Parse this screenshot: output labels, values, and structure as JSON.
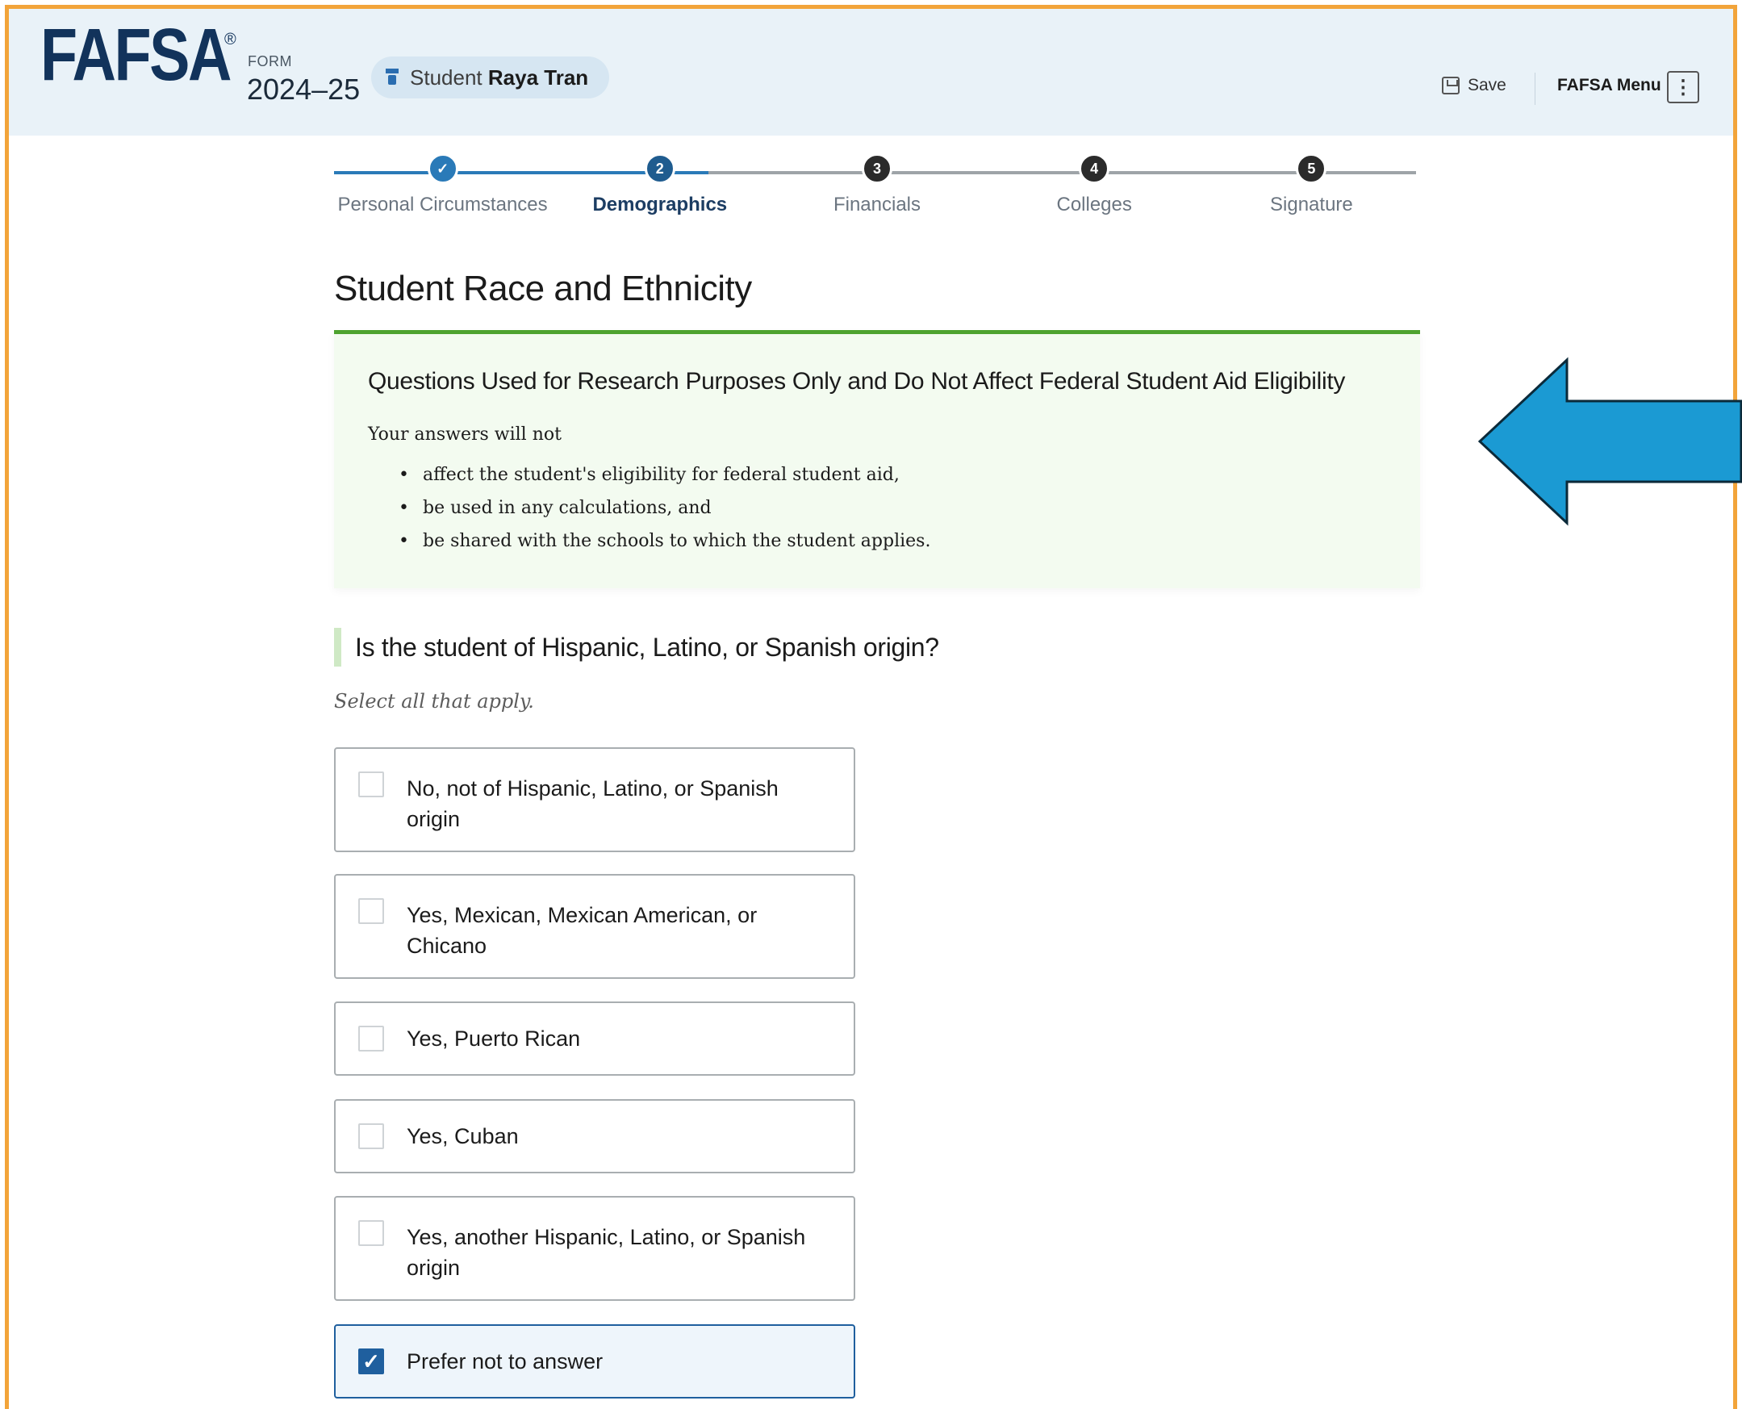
{
  "header": {
    "logo": "FAFSA",
    "logo_mark": "®",
    "form_label": "FORM",
    "form_year": "2024–25",
    "student_role": "Student",
    "student_name": "Raya Tran",
    "save_label": "Save",
    "menu_label": "FAFSA Menu",
    "menu_icon": "⋮"
  },
  "stepper": {
    "steps": [
      {
        "label": "Personal Circumstances",
        "number": "✓",
        "state": "complete"
      },
      {
        "label": "Demographics",
        "number": "2",
        "state": "current"
      },
      {
        "label": "Financials",
        "number": "3",
        "state": "upcoming"
      },
      {
        "label": "Colleges",
        "number": "4",
        "state": "upcoming"
      },
      {
        "label": "Signature",
        "number": "5",
        "state": "upcoming"
      }
    ],
    "colors": {
      "complete": "#2a7ab8",
      "current": "#1f5c8f",
      "upcoming": "#2b2b2b",
      "track_done": "#2a7ab8",
      "track_todo": "#9ea4a8"
    }
  },
  "page": {
    "title": "Student Race and Ethnicity"
  },
  "research": {
    "heading": "Questions Used for Research Purposes Only and Do Not Affect Federal Student Aid Eligibility",
    "lead": "Your answers will not",
    "bullets": [
      "affect the student's eligibility for federal student aid,",
      "be used in any calculations, and",
      "be shared with the schools to which the student applies."
    ],
    "accent": "#4ea32f"
  },
  "callout_arrow": {
    "color": "#1b9ad3",
    "icon": "arrow-left"
  },
  "question": {
    "text": "Is the student of Hispanic, Latino, or Spanish origin?",
    "hint": "Select all that apply.",
    "options": [
      {
        "label": "No, not of Hispanic, Latino, or Spanish origin",
        "checked": false
      },
      {
        "label": "Yes, Mexican, Mexican American, or Chicano",
        "checked": false
      },
      {
        "label": "Yes, Puerto Rican",
        "checked": false
      },
      {
        "label": "Yes, Cuban",
        "checked": false
      },
      {
        "label": "Yes, another Hispanic, Latino, or Spanish origin",
        "checked": false
      },
      {
        "label": "Prefer not to answer",
        "checked": true
      }
    ]
  }
}
